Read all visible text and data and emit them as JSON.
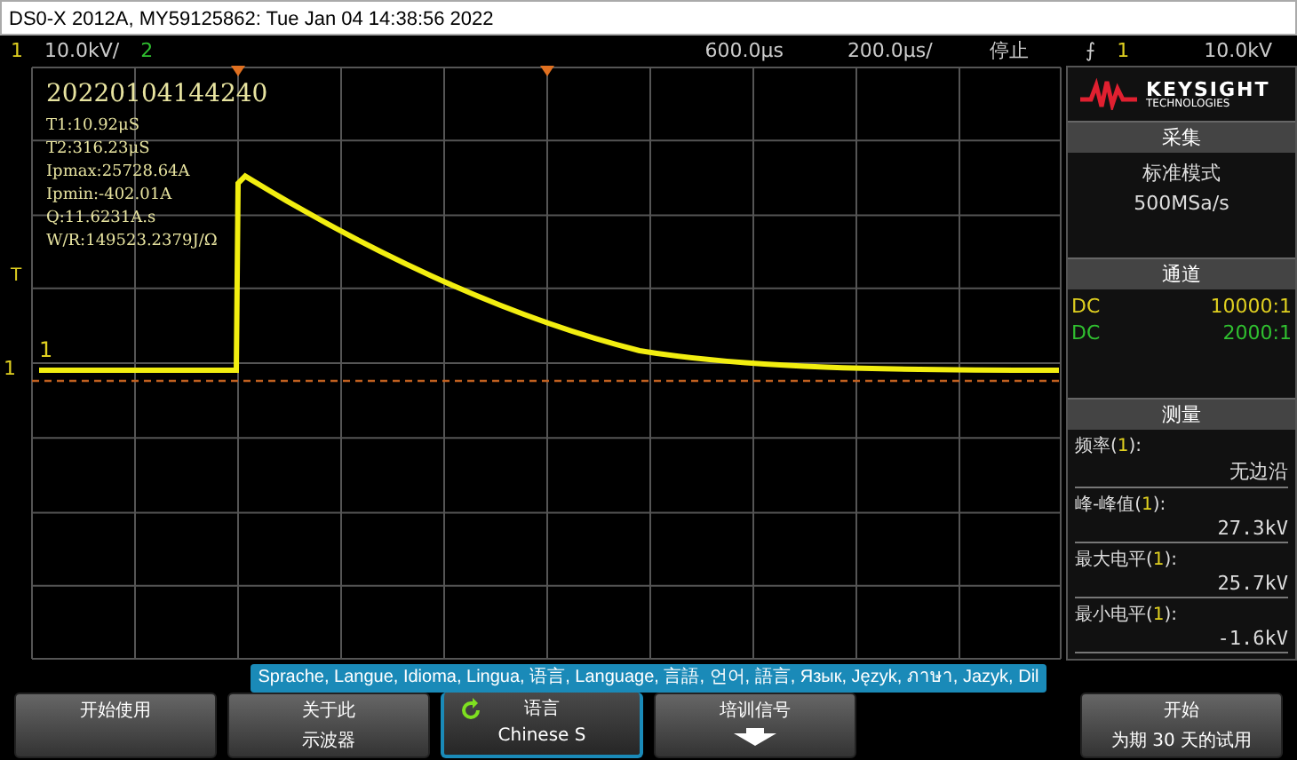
{
  "window": {
    "title": "DS0-X 2012A, MY59125862: Tue Jan 04 14:38:56 2022"
  },
  "status_bar": {
    "ch1": "1",
    "ch1_scale": "10.0kV/",
    "ch2": "2",
    "delay": "600.0µs",
    "timebase": "200.0µs/",
    "run_state": "停止",
    "trigger_icon": "⨍",
    "trigger_source": "1",
    "trigger_level": "10.0kV"
  },
  "screen": {
    "timestamp": "20220104144240",
    "measurements": [
      "T1:10.92μS",
      "T2:316.23μS",
      "Ipmax:25728.64A",
      "Ipmin:-402.01A",
      "Q:11.6231A.s",
      "W/R:149523.2379J/Ω"
    ],
    "trigger_marker": "T",
    "channel_marker": "1",
    "ground_marker": "1"
  },
  "panel": {
    "logo_line1": "KEYSIGHT",
    "logo_line2": "TECHNOLOGIES",
    "acquisition": {
      "header": "采集",
      "mode": "标准模式",
      "rate": "500MSa/s"
    },
    "channels": {
      "header": "通道",
      "rows": [
        {
          "coupling": "DC",
          "ratio": "10000:1",
          "color": "#e0d020"
        },
        {
          "coupling": "DC",
          "ratio": "2000:1",
          "color": "#30c030"
        }
      ]
    },
    "measure": {
      "header": "测量",
      "items": [
        {
          "label": "频率(**1**):",
          "value": "无边沿"
        },
        {
          "label": "峰-峰值(**1**):",
          "value": "27.3kV"
        },
        {
          "label": "最大电平(**1**):",
          "value": "25.7kV"
        },
        {
          "label": "最小电平(**1**):",
          "value": "-1.6kV"
        }
      ]
    }
  },
  "language_banner": "Sprache, Langue, Idioma, Lingua, 语言, Language, 言語, 언어, 語言, Язык, Język, ภาษา, Jazyk, Dil",
  "softkeys": [
    {
      "kind": "text",
      "lines": [
        "开始使用"
      ],
      "selected": false
    },
    {
      "kind": "text",
      "lines": [
        "关于此",
        "示波器"
      ],
      "selected": false
    },
    {
      "kind": "cycle",
      "lines": [
        "语言",
        "Chinese S"
      ],
      "selected": true
    },
    {
      "kind": "menu",
      "lines": [
        "培训信号"
      ],
      "selected": false
    },
    {
      "kind": "text",
      "lines": [
        "开始",
        "为期 30 天的试用"
      ],
      "selected": false
    }
  ]
}
